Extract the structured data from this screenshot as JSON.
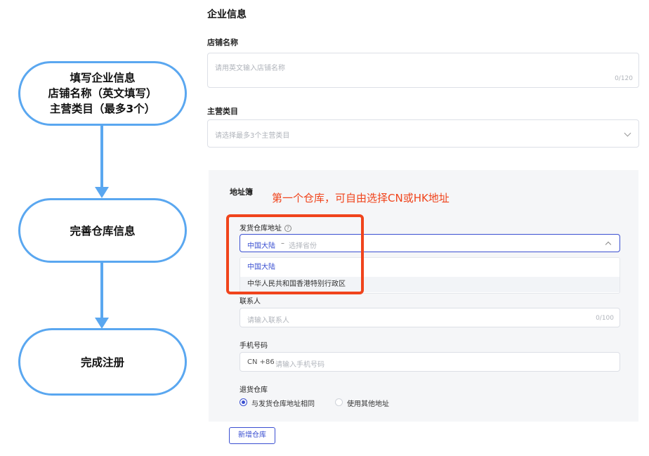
{
  "flow": {
    "step1": {
      "line1": "填写企业信息",
      "line2": "店铺名称（英文填写）",
      "line3": "主营类目（最多3个）"
    },
    "step2": "完善仓库信息",
    "step3": "完成注册",
    "color": "#5aa7f0"
  },
  "form": {
    "section_title": "企业信息",
    "store_name": {
      "label": "店铺名称",
      "placeholder": "请用英文输入店铺名称",
      "counter": "0/120"
    },
    "category": {
      "label": "主营类目",
      "placeholder": "请选择最多3个主营类目"
    },
    "address_book": {
      "title": "地址簿",
      "annotation": "第一个仓库，可自由选择CN或HK地址",
      "annotation_color": "#f0441c",
      "ship_warehouse": {
        "label": "发货仓库地址",
        "help_icon": "?",
        "selected_value": "中国大陆",
        "separator": "–",
        "province_placeholder": "选择省份",
        "options": [
          "中国大陆",
          "中华人民共和国香港特别行政区"
        ]
      },
      "contact": {
        "label": "联系人",
        "placeholder": "请输入联系人",
        "counter": "0/100"
      },
      "phone": {
        "label": "手机号码",
        "prefix": "CN +86",
        "placeholder": "请输入手机号码"
      },
      "return_warehouse": {
        "label": "退货仓库",
        "options": [
          {
            "label": "与发货仓库地址相同",
            "selected": true
          },
          {
            "label": "使用其他地址",
            "selected": false
          }
        ]
      },
      "add_button": "新增仓库"
    },
    "accent_color": "#3a4fd1"
  }
}
